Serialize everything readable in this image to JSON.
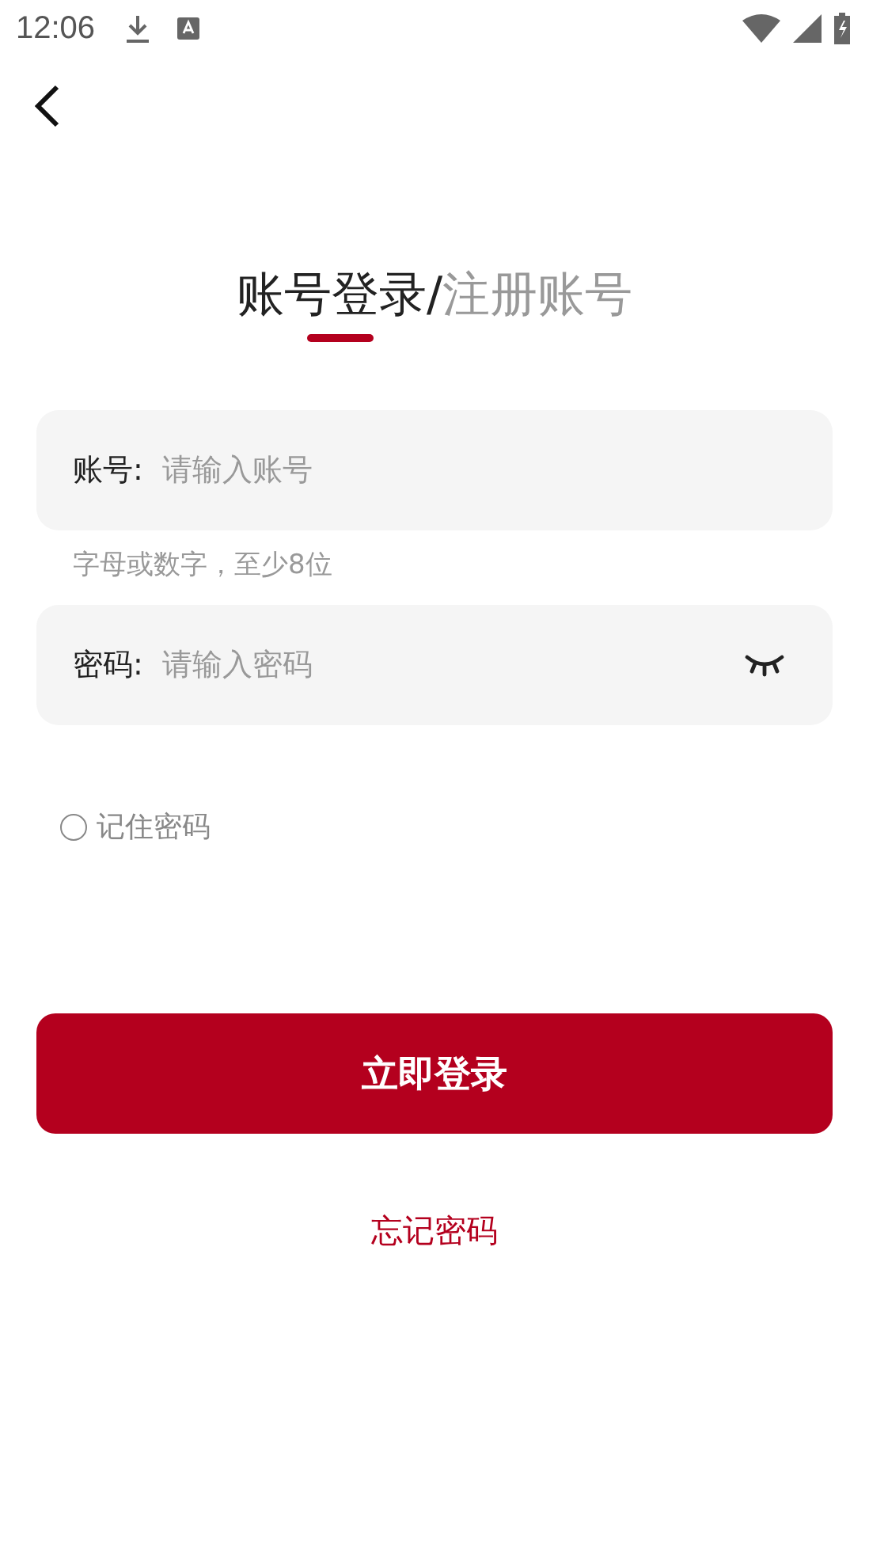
{
  "status_bar": {
    "time": "12:06"
  },
  "tabs": [
    {
      "label": "账号登录",
      "selected": true
    },
    {
      "label": "注册账号",
      "selected": false
    }
  ],
  "tab_separator": "/",
  "fields": [
    {
      "label": "账号:",
      "placeholder": "请输入账号",
      "hint": "字母或数字，至少8位",
      "kind": "text"
    },
    {
      "label": "密码:",
      "placeholder": "请输入密码",
      "kind": "password"
    }
  ],
  "remember": {
    "label": "记住密码",
    "checked": false
  },
  "login_button": "立即登录",
  "forgot_link": "忘记密码"
}
